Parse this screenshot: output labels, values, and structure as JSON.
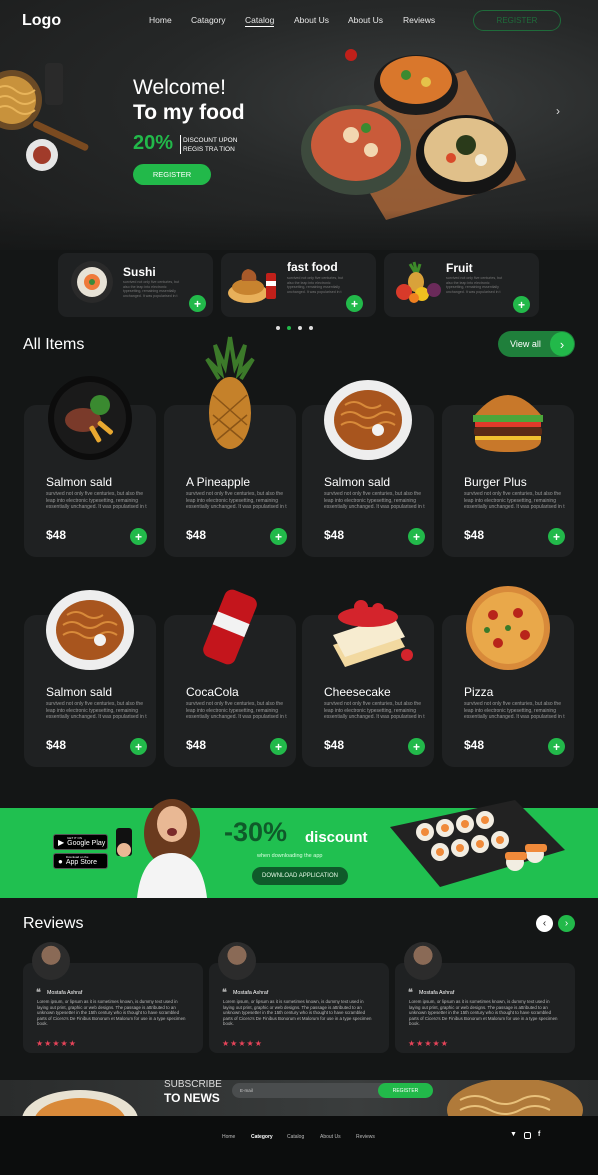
{
  "nav": {
    "logo": "Logo",
    "links": [
      "Home",
      "Catagory",
      "Catalog",
      "About Us",
      "About Us",
      "Reviews"
    ],
    "register": "REGISTER"
  },
  "hero": {
    "welcome": "Welcome!",
    "title": "To my food",
    "percent": "20%",
    "discount_text": "DISCOUNT UPON REGIS TRA TION",
    "register": "REGISTER",
    "arrow": "›"
  },
  "categories": [
    {
      "title": "Sushi",
      "desc": "survived not only five centuries, but also the leap into electronic typesetting, remaining essentially unchanged. It was popularised in t"
    },
    {
      "title": "fast food",
      "desc": "survived not only five centuries, but also the leap into electronic typesetting, remaining essentially unchanged. It was popularised in t"
    },
    {
      "title": "Fruit",
      "desc": "survived not only five centuries, but also the leap into electronic typesetting, remaining essentially unchanged. It was popularised in t"
    }
  ],
  "all_items": {
    "title": "All Items",
    "view_all": "View all",
    "items": [
      {
        "name": "Salmon sald",
        "price": "$48",
        "desc": "survived not only five centuries, but also the leap into electronic typesetting, remaining essentially unchanged. It was popularised in t"
      },
      {
        "name": "A Pineapple",
        "price": "$48",
        "desc": "survived not only five centuries, but also the leap into electronic typesetting, remaining essentially unchanged. It was popularised in t"
      },
      {
        "name": "Salmon sald",
        "price": "$48",
        "desc": "survived not only five centuries, but also the leap into electronic typesetting, remaining essentially unchanged. It was popularised in t"
      },
      {
        "name": "Burger Plus",
        "price": "$48",
        "desc": "survived not only five centuries, but also the leap into electronic typesetting, remaining essentially unchanged. It was popularised in t"
      },
      {
        "name": "Salmon sald",
        "price": "$48",
        "desc": "survived not only five centuries, but also the leap into electronic typesetting, remaining essentially unchanged. It was popularised in t"
      },
      {
        "name": "CocaCola",
        "price": "$48",
        "desc": "survived not only five centuries, but also the leap into electronic typesetting, remaining essentially unchanged. It was popularised in t"
      },
      {
        "name": "Cheesecake",
        "price": "$48",
        "desc": "survived not only five centuries, but also the leap into electronic typesetting, remaining essentially unchanged. It was popularised in t"
      },
      {
        "name": "Pizza",
        "price": "$48",
        "desc": "survived not only five centuries, but also the leap into electronic typesetting, remaining essentially unchanged. It was popularised in t"
      }
    ]
  },
  "promo": {
    "percent": "-30%",
    "discount": "discount",
    "subtitle": "when downloading the app",
    "button": "DOWNLOAD APPLICATION",
    "google_small": "GET IT ON",
    "google_big": "Google Play",
    "apple_small": "Download on the",
    "apple_big": "App Store"
  },
  "reviews": {
    "title": "Reviews",
    "prev": "‹",
    "next": "›",
    "items": [
      {
        "name": "Mostafa Ashraf",
        "text": "Lorem ipsum, or lipsum as it is sometimes known, is dummy text used in laying out print, graphic or web designs. The passage is attributed to an unknown typesetter in the 15th century who is thought to have scrambled parts of Cicero's De Finibus Bonorum et Malorum for use in a type specimen book.",
        "stars": "★★★★★"
      },
      {
        "name": "Mostafa Ashraf",
        "text": "Lorem ipsum, or lipsum as it is sometimes known, is dummy text used in laying out print, graphic or web designs. The passage is attributed to an unknown typesetter in the 15th century who is thought to have scrambled parts of Cicero's De Finibus Bonorum et Malorum for use in a type specimen book.",
        "stars": "★★★★★"
      },
      {
        "name": "Mostafa Ashraf",
        "text": "Lorem ipsum, or lipsum as it is sometimes known, is dummy text used in laying out print, graphic or web designs. The passage is attributed to an unknown typesetter in the 15th century who is thought to have scrambled parts of Cicero's De Finibus Bonorum et Malorum for use in a type specimen book.",
        "stars": "★★★★★"
      }
    ]
  },
  "newsletter": {
    "subscribe": "SUBSCRIBE",
    "to_news": "TO NEWS",
    "placeholder": "E-mail",
    "button": "REGISTER"
  },
  "footer": {
    "links": [
      "Home",
      "Category",
      "Catalog",
      "About Us",
      "Reviews"
    ],
    "social": [
      "twitter-icon",
      "instagram-icon",
      "facebook-icon"
    ]
  },
  "colors": {
    "accent": "#22b94a",
    "background": "#141616",
    "card": "#1f2122",
    "star": "#e8445a"
  }
}
